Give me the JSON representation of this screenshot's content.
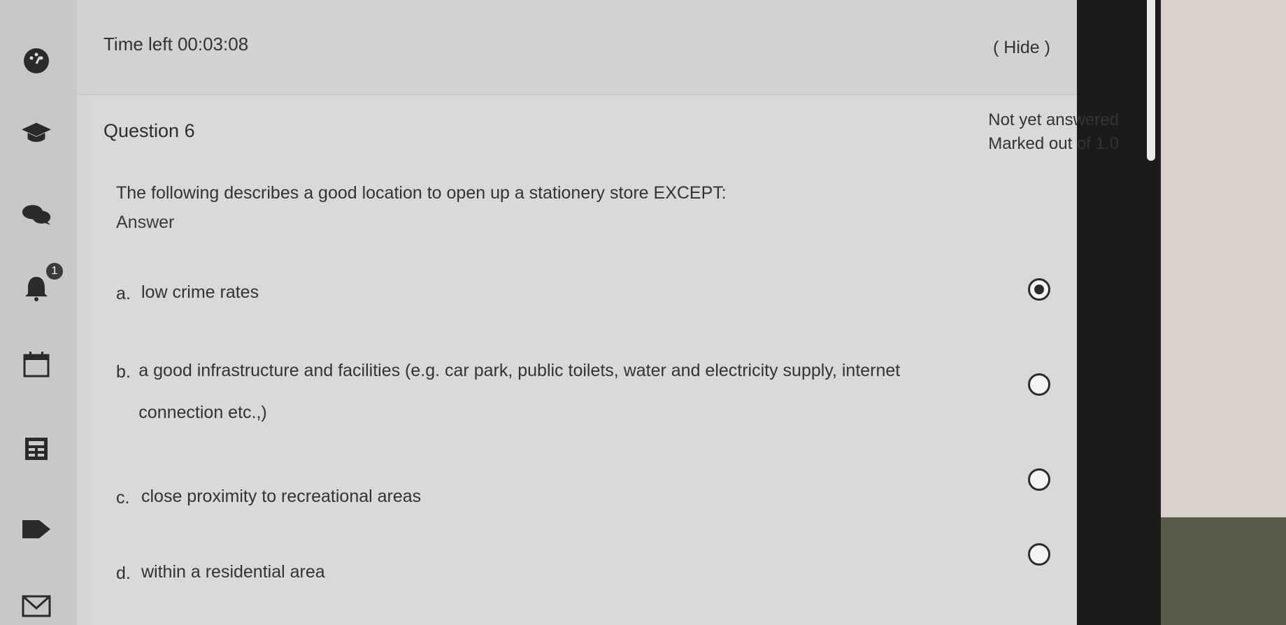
{
  "timer": {
    "label": "Time left",
    "value": "00:03:08",
    "hide_label": "( Hide )"
  },
  "question": {
    "title": "Question 6",
    "status": "Not yet answered",
    "marks": "Marked out of 1.0",
    "text": "The following describes a good location to open up a stationery store EXCEPT:",
    "answer_label": "Answer",
    "options": [
      {
        "letter": "a.",
        "text": "low crime rates",
        "selected": true
      },
      {
        "letter": "b.",
        "text": "a good infrastructure and facilities (e.g. car park, public toilets, water and electricity supply, internet connection etc.,)",
        "selected": false
      },
      {
        "letter": "c.",
        "text": "close proximity to recreational areas",
        "selected": false
      },
      {
        "letter": "d.",
        "text": "within a residential area",
        "selected": false
      }
    ]
  },
  "sidebar": {
    "icons": [
      "dashboard-icon",
      "graduation-cap-icon",
      "chat-icon",
      "bell-icon",
      "calendar-icon",
      "grades-icon",
      "tag-icon",
      "mail-icon"
    ],
    "notification_count": "1"
  }
}
